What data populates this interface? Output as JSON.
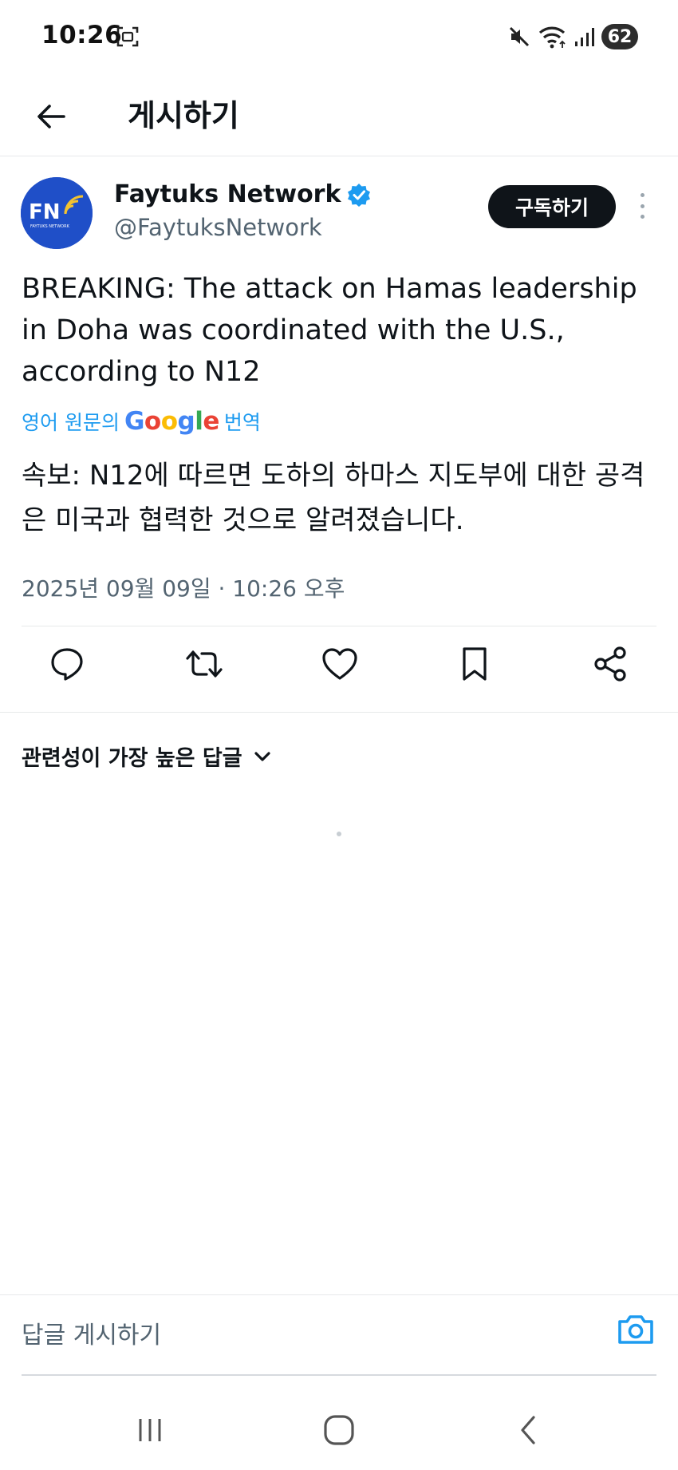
{
  "status_bar": {
    "time": "10:26",
    "battery": "62",
    "icons": [
      "screenshot-icon",
      "mute-icon",
      "wifi-icon",
      "signal-icon"
    ]
  },
  "header": {
    "title": "게시하기",
    "back_icon": "arrow-left-icon"
  },
  "post": {
    "author_name": "Faytuks Network",
    "author_handle": "@FaytuksNetwork",
    "avatar_text": "FN",
    "avatar_subtext": "FAYTUKS NETWORK",
    "subscribe_label": "구독하기",
    "text": "BREAKING: The attack on Hamas leadership in Doha was coordinated with the U.S., according to N12",
    "translate_prefix": "영어 원문의",
    "translate_brand": "Google",
    "translate_suffix": "번역",
    "translated_text": "속보: N12에 따르면 도하의 하마스 지도부에 대한 공격은 미국과 협력한 것으로 알려졌습니다.",
    "date": "2025년 09월 09일 · 10:26 오후"
  },
  "actions": [
    {
      "name": "reply-icon"
    },
    {
      "name": "repost-icon"
    },
    {
      "name": "like-icon"
    },
    {
      "name": "bookmark-icon"
    },
    {
      "name": "share-icon"
    }
  ],
  "replies": {
    "sort_label": "관련성이 가장 높은 답글"
  },
  "reply_bar": {
    "placeholder": "답글 게시하기"
  },
  "colors": {
    "accent": "#1d9bf0",
    "text": "#0f1419",
    "muted": "#536471",
    "avatar_bg": "#1f4fc8",
    "google_blue": "#4285F4",
    "google_red": "#EA4335",
    "google_yellow": "#FBBC05",
    "google_green": "#34A853"
  }
}
